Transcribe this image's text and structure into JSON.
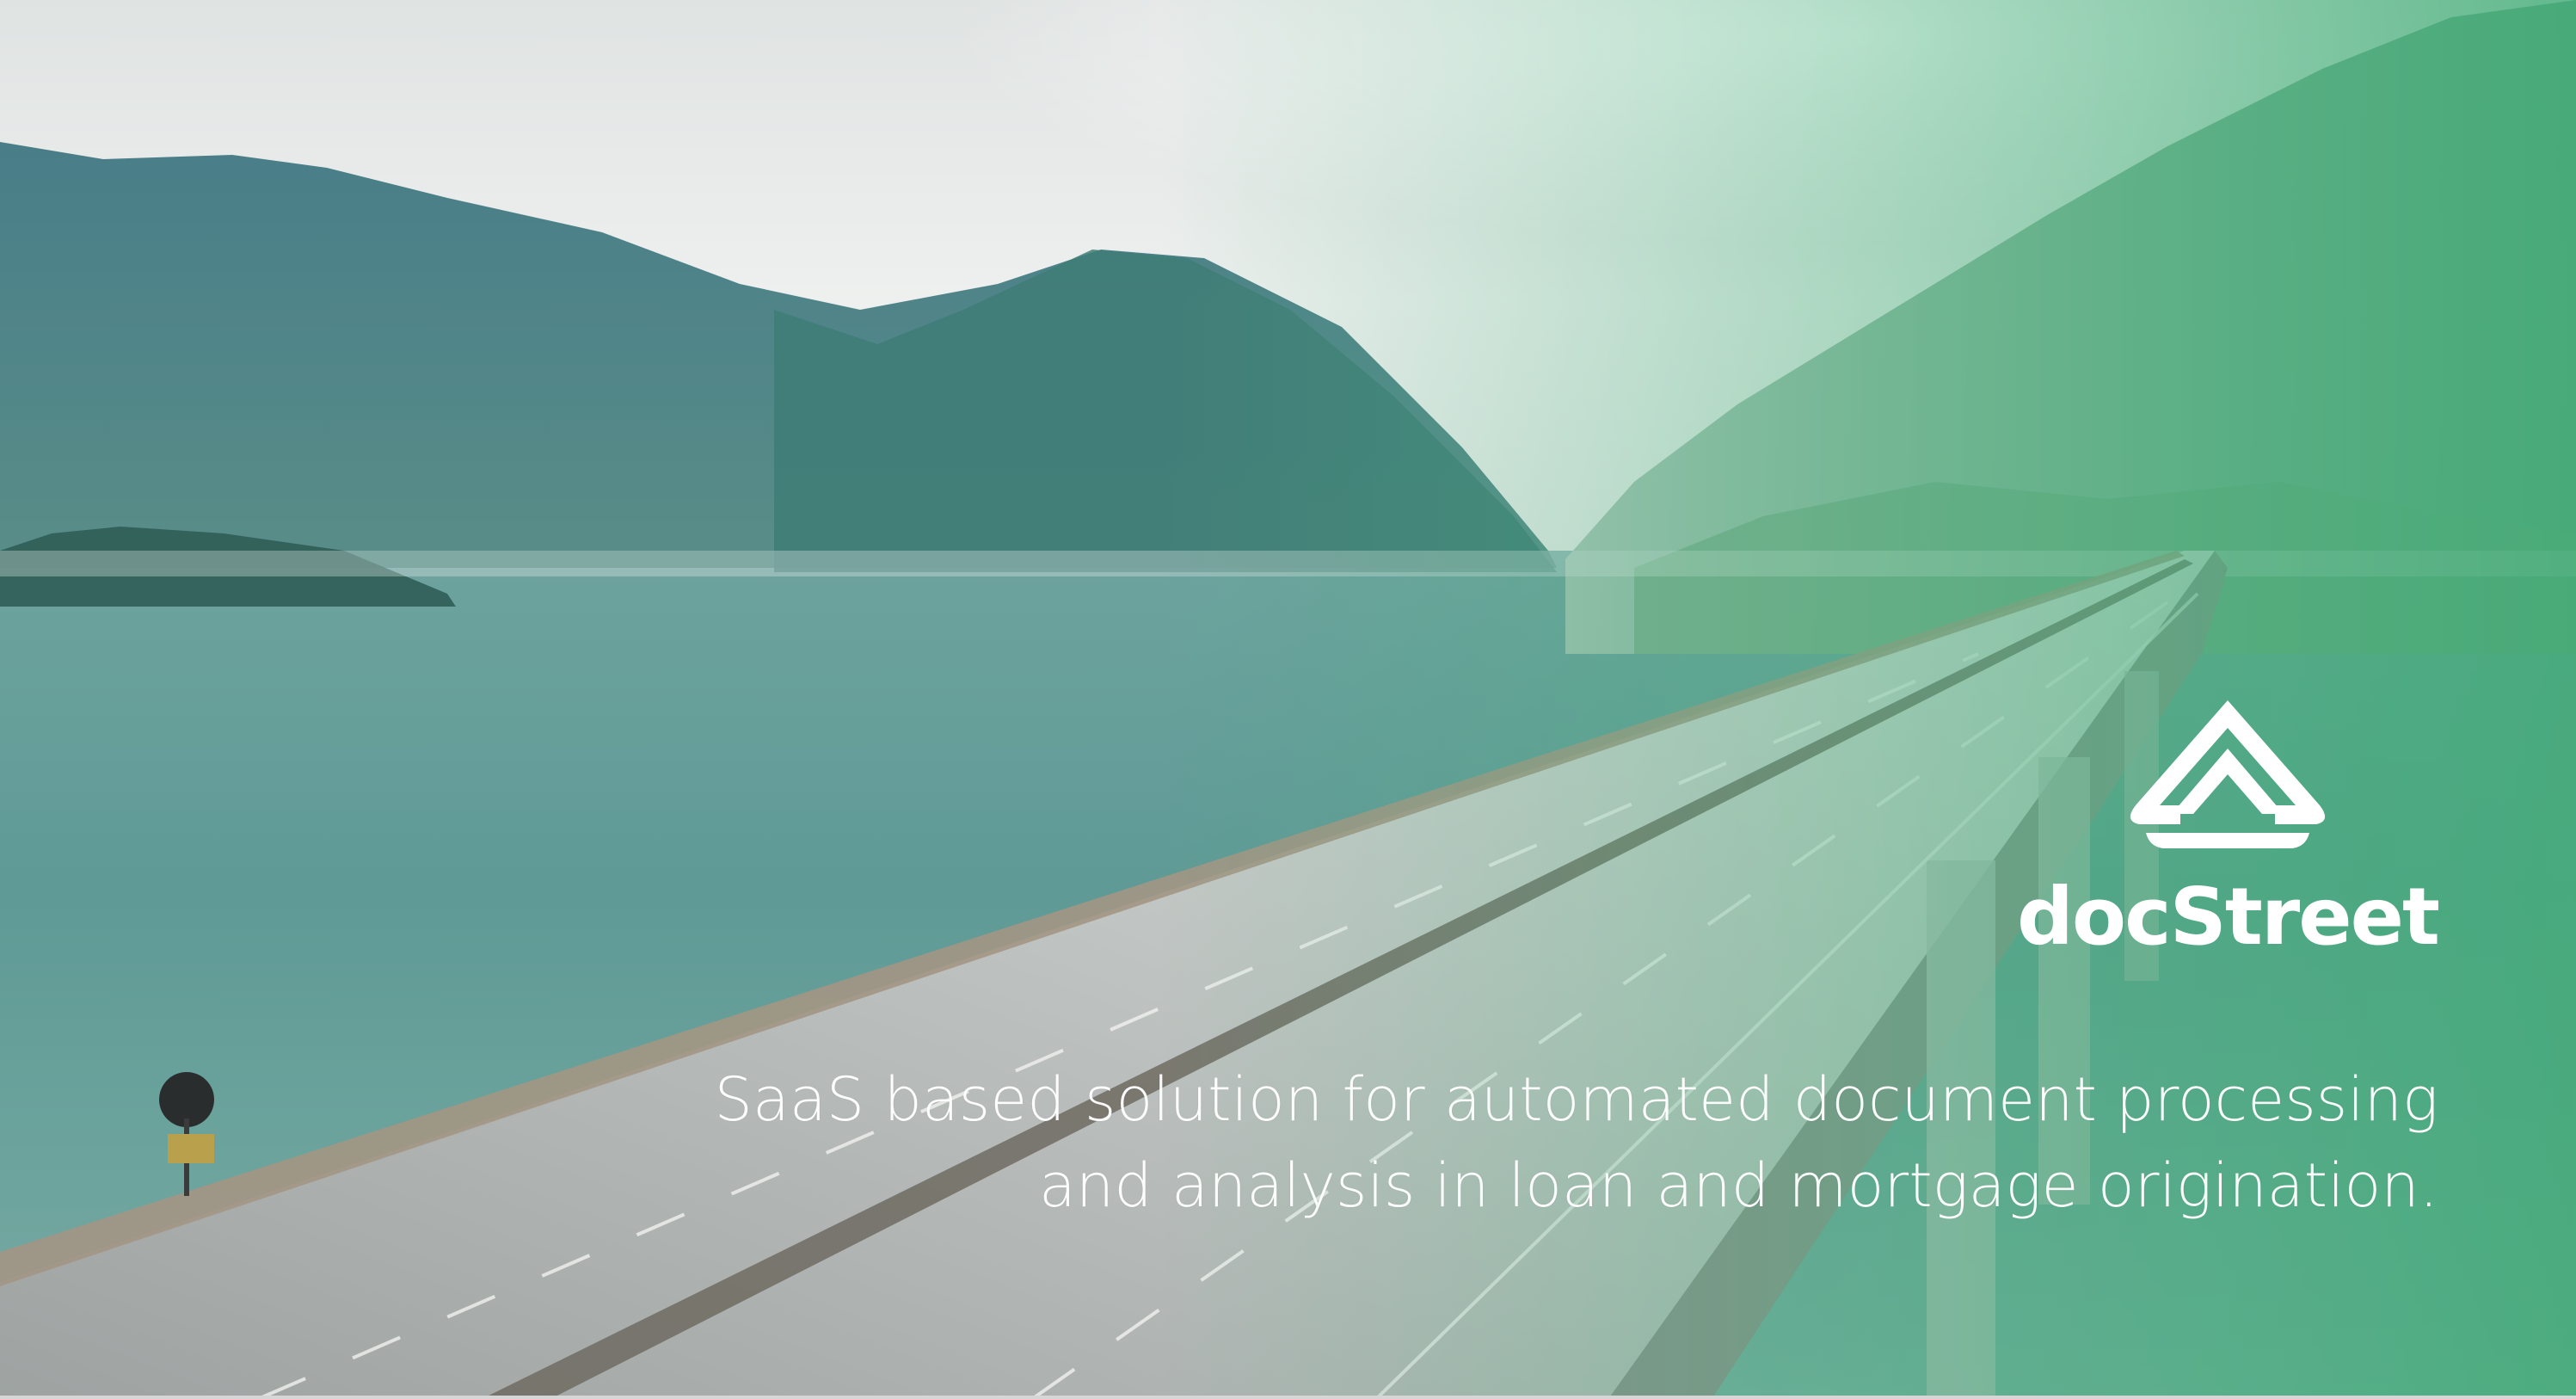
{
  "brand": {
    "name": "docStreet",
    "logo_icon": "docstreet-arrow-icon",
    "accent_color": "#5fb88a"
  },
  "tagline": {
    "line1": "SaaS based solution for automated document processing",
    "line2": "and analysis in loan and mortgage origination."
  },
  "background": {
    "icon": "highway-bridge-landscape-photo",
    "sky_color": "#e9ecea",
    "water_color": "#6fa6a0",
    "mountain_color": "#3f7d7f",
    "tint_color": "#49b27d"
  }
}
